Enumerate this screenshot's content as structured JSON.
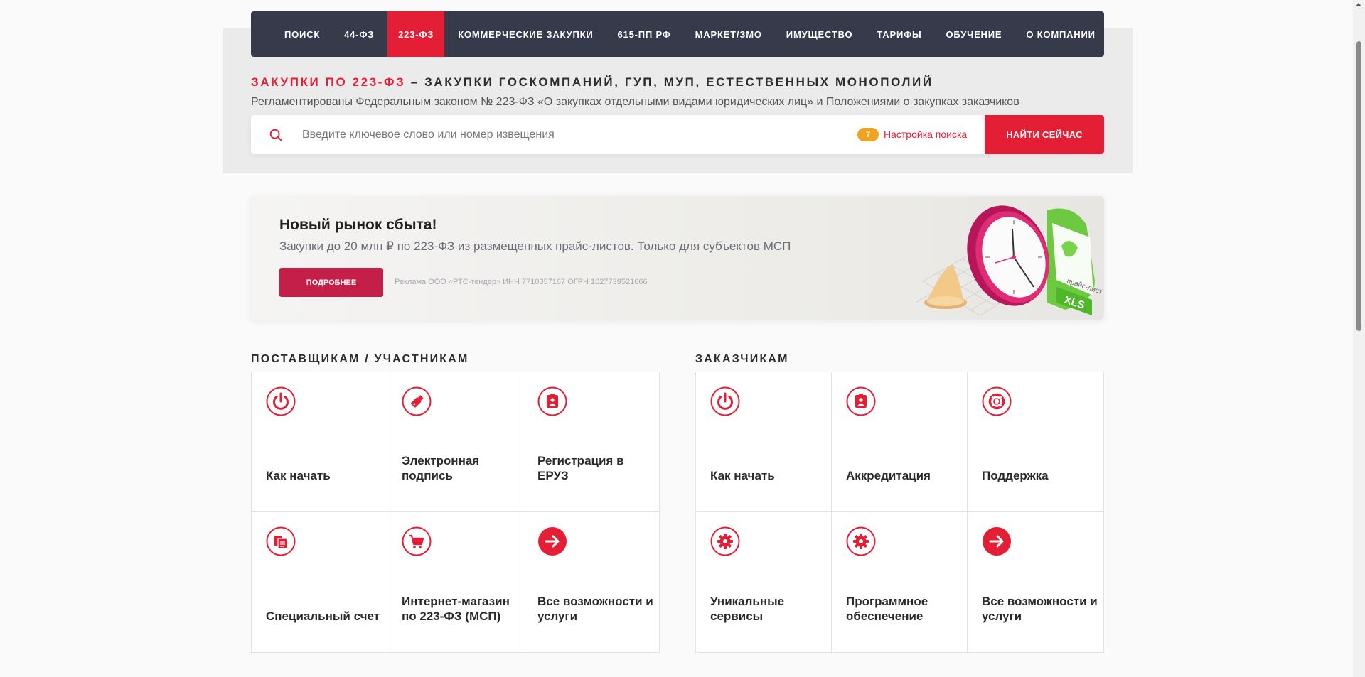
{
  "nav": {
    "items": [
      {
        "label": "ПОИСК",
        "active": false
      },
      {
        "label": "44-ФЗ",
        "active": false
      },
      {
        "label": "223-ФЗ",
        "active": true
      },
      {
        "label": "КОММЕРЧЕСКИЕ ЗАКУПКИ",
        "active": false
      },
      {
        "label": "615-ПП РФ",
        "active": false
      },
      {
        "label": "МАРКЕТ/ЗМО",
        "active": false
      },
      {
        "label": "ИМУЩЕСТВО",
        "active": false
      },
      {
        "label": "ТАРИФЫ",
        "active": false
      },
      {
        "label": "ОБУЧЕНИЕ",
        "active": false
      },
      {
        "label": "О КОМПАНИИ",
        "active": false
      }
    ]
  },
  "hero": {
    "title_accent": "ЗАКУПКИ ПО 223-ФЗ",
    "title_rest": " – ЗАКУПКИ ГОСКОМПАНИЙ, ГУП, МУП, ЕСТЕСТВЕННЫХ МОНОПОЛИЙ",
    "subtitle": "Регламентированы Федеральным законом № 223-ФЗ «О закупках отдельными видами юридических лиц» и Положениями о закупках заказчиков"
  },
  "search": {
    "placeholder": "Введите ключевое слово или номер извещения",
    "value": "",
    "settings_count": "7",
    "settings_label": "Настройка поиска",
    "button_label": "НАЙТИ СЕЙЧАС",
    "icon": "search-icon"
  },
  "promo": {
    "title": "Новый рынок сбыта!",
    "text": "Закупки до 20 млн ₽ по 223-ФЗ из размещенных прайс-листов. Только для субъектов МСП",
    "button_label": "ПОДРОБНЕЕ",
    "ad_note": "Реклама ООО «РТС-тендер» ИНН 7710357167 ОГРН 1027739521666",
    "art_label_pricelist": "прайс-лист",
    "art_label_xls": "XLS"
  },
  "suppliers": {
    "title": "ПОСТАВЩИКАМ / УЧАСТНИКАМ",
    "tiles": [
      {
        "label": "Как начать",
        "icon": "power-icon"
      },
      {
        "label": "Электронная подпись",
        "icon": "usb-key-icon"
      },
      {
        "label": "Регистрация в ЕРУЗ",
        "icon": "id-badge-icon"
      },
      {
        "label": "Специальный счет",
        "icon": "document-stack-icon"
      },
      {
        "label": "Интернет-магазин по 223-ФЗ (МСП)",
        "icon": "cart-icon"
      },
      {
        "label": "Все возможности и услуги",
        "icon": "arrow-right-icon"
      }
    ]
  },
  "customers": {
    "title": "ЗАКАЗЧИКАМ",
    "tiles": [
      {
        "label": "Как начать",
        "icon": "power-icon"
      },
      {
        "label": "Аккредитация",
        "icon": "id-badge-icon"
      },
      {
        "label": "Поддержка",
        "icon": "lifebuoy-icon"
      },
      {
        "label": "Уникальные сервисы",
        "icon": "gear-icon"
      },
      {
        "label": "Программное обеспечение",
        "icon": "gear-icon"
      },
      {
        "label": "Все возможности и услуги",
        "icon": "arrow-right-icon"
      }
    ]
  },
  "colors": {
    "accent": "#e31e35",
    "nav_bg": "#363a4a",
    "promo_button": "#c41f48",
    "badge": "#f0a321"
  }
}
